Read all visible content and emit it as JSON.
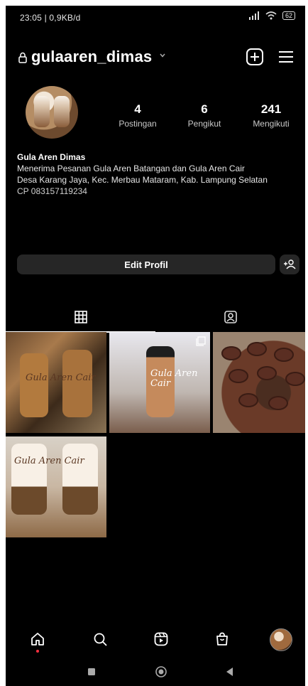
{
  "status_bar": {
    "time_text": "23:05 | 0,9KB/d",
    "signal_icon": "signal-icon",
    "wifi_icon": "wifi-icon",
    "battery_text": "62"
  },
  "header": {
    "username": "gulaaren_dimas",
    "lock_icon": "lock-icon",
    "chevron_icon": "chevron-down-icon",
    "new_post_icon": "plus-square-icon",
    "menu_icon": "hamburger-menu-icon"
  },
  "stats": [
    {
      "value": "4",
      "label": "Postingan"
    },
    {
      "value": "6",
      "label": "Pengikut"
    },
    {
      "value": "241",
      "label": "Mengikuti"
    }
  ],
  "bio": {
    "name": "Gula Aren Dimas",
    "line1": "Menerima Pesanan Gula Aren Batangan dan Gula Aren Cair",
    "line2": "Desa Karang Jaya, Kec. Merbau Mataram, Kab. Lampung Selatan",
    "contact": "CP 083157119234"
  },
  "edit_profile_label": "Edit Profil",
  "tabs": {
    "grid_icon": "grid-icon",
    "tagged_icon": "tagged-person-icon"
  },
  "posts": [
    {
      "id": "post-1",
      "caption_text": "Gula Aren Cair"
    },
    {
      "id": "post-2",
      "caption_text": "Gula Aren Cair"
    },
    {
      "id": "post-3",
      "caption_text": ""
    },
    {
      "id": "post-4",
      "caption_text": "Gula Aren Cair"
    }
  ],
  "bottom_nav": {
    "home": "home-icon",
    "search": "search-icon",
    "reels": "reels-icon",
    "shop": "shopping-bag-icon",
    "profile": "profile-avatar-icon"
  },
  "system_nav": {
    "recents": "recents-square-icon",
    "home": "home-circle-icon",
    "back": "back-triangle-icon"
  },
  "colors": {
    "background": "#000000",
    "button_bg": "#262626",
    "notification_dot": "#ff3040"
  }
}
